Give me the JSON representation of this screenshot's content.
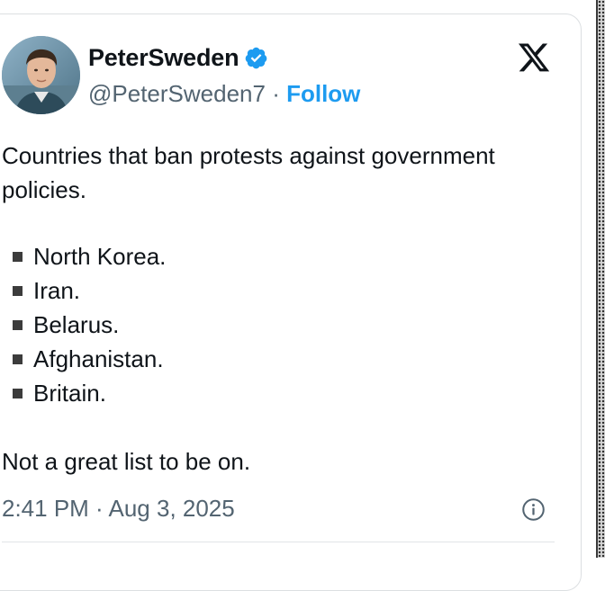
{
  "author": {
    "display_name": "PeterSweden",
    "handle": "@PeterSweden7",
    "separator": "·",
    "follow_label": "Follow",
    "verified_icon": "verified-badge-icon",
    "verified_color": "#1d9bf0"
  },
  "platform_icon": "x-logo-icon",
  "tweet": {
    "intro": "Countries that ban protests against government policies.",
    "list": [
      "North Korea.",
      "Iran.",
      "Belarus.",
      "Afghanistan.",
      "Britain."
    ],
    "closing": "Not a great list to be on.",
    "timestamp": "2:41 PM · Aug 3, 2025"
  },
  "info_icon": "info-icon",
  "colors": {
    "text": "#0f1419",
    "secondary": "#536471",
    "accent": "#1d9bf0"
  }
}
